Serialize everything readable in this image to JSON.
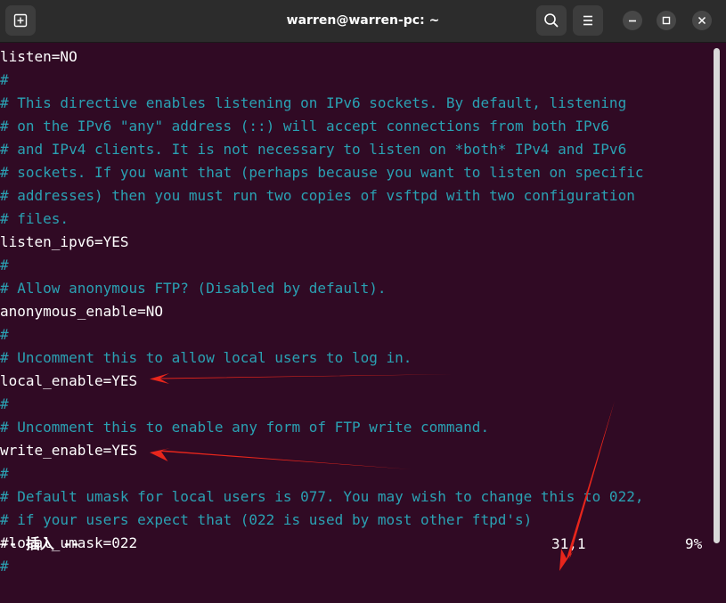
{
  "window": {
    "title": "warren@warren-pc: ~"
  },
  "titlebar_icons": {
    "new_tab": "new-tab-icon",
    "search": "search-icon",
    "menu": "hamburger-menu-icon",
    "minimize": "minimize-icon",
    "maximize": "maximize-icon",
    "close": "close-icon"
  },
  "editor": {
    "lines": [
      {
        "text": "listen=NO",
        "type": "setting"
      },
      {
        "text": "#",
        "type": "comment"
      },
      {
        "text": "# This directive enables listening on IPv6 sockets. By default, listening",
        "type": "comment"
      },
      {
        "text": "# on the IPv6 \"any\" address (::) will accept connections from both IPv6",
        "type": "comment"
      },
      {
        "text": "# and IPv4 clients. It is not necessary to listen on *both* IPv4 and IPv6",
        "type": "comment"
      },
      {
        "text": "# sockets. If you want that (perhaps because you want to listen on specific",
        "type": "comment"
      },
      {
        "text": "# addresses) then you must run two copies of vsftpd with two configuration",
        "type": "comment"
      },
      {
        "text": "# files.",
        "type": "comment"
      },
      {
        "text": "listen_ipv6=YES",
        "type": "setting"
      },
      {
        "text": "#",
        "type": "comment"
      },
      {
        "text": "# Allow anonymous FTP? (Disabled by default).",
        "type": "comment"
      },
      {
        "text": "anonymous_enable=NO",
        "type": "setting"
      },
      {
        "text": "#",
        "type": "comment"
      },
      {
        "text": "# Uncomment this to allow local users to log in.",
        "type": "comment"
      },
      {
        "text": "local_enable=YES",
        "type": "setting"
      },
      {
        "text": "#",
        "type": "comment"
      },
      {
        "text": "# Uncomment this to enable any form of FTP write command.",
        "type": "comment"
      },
      {
        "text": "write_enable=YES",
        "type": "setting"
      },
      {
        "text": "#",
        "type": "comment"
      },
      {
        "text": "# Default umask for local users is 077. You may wish to change this to 022,",
        "type": "comment"
      },
      {
        "text": "# if your users expect that (022 is used by most other ftpd's)",
        "type": "comment"
      },
      {
        "text": "#local_umask=022",
        "type": "setting"
      },
      {
        "text": "#",
        "type": "comment"
      }
    ]
  },
  "status": {
    "mode": "-- 插入 --",
    "position": "31,1",
    "percent": "9%"
  },
  "colors": {
    "background": "#300a24",
    "comment": "#2aa1b3",
    "text": "#ffffff",
    "annotation_arrow": "#e8261c"
  }
}
